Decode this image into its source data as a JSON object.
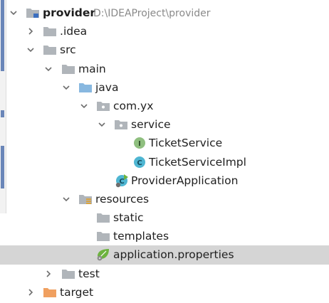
{
  "tree": {
    "root": {
      "name": "provider",
      "path": "D:\\IDEAProject\\provider"
    },
    "idea": "idea",
    "src": "src",
    "main": "main",
    "java": "java",
    "package": "com.yx",
    "service_pkg": "service",
    "ticket_service": "TicketService",
    "ticket_service_impl": "TicketServiceImpl",
    "provider_app": "ProviderApplication",
    "resources": "resources",
    "static": "static",
    "templates": "templates",
    "app_properties": "application.properties",
    "test": "test",
    "target": "target"
  },
  "colors": {
    "selection": "#d5d5d5",
    "folder_gray": "#b0b5ba",
    "folder_blue": "#88b8e0",
    "folder_orange": "#f0a060",
    "interface_green": "#8fbf7f",
    "class_cyan": "#4fb6d2",
    "spring_green": "#6db33f"
  },
  "icons": {
    "expanded": "chevron-down-icon",
    "collapsed": "chevron-right-icon",
    "module": "module-folder-icon",
    "folder": "folder-icon",
    "source_root": "source-root-folder-icon",
    "package": "package-icon",
    "interface": "interface-icon",
    "class": "class-icon",
    "spring_boot_class": "spring-boot-class-icon",
    "resources_root": "resources-root-folder-icon",
    "properties": "spring-properties-icon",
    "excluded": "excluded-folder-icon"
  }
}
